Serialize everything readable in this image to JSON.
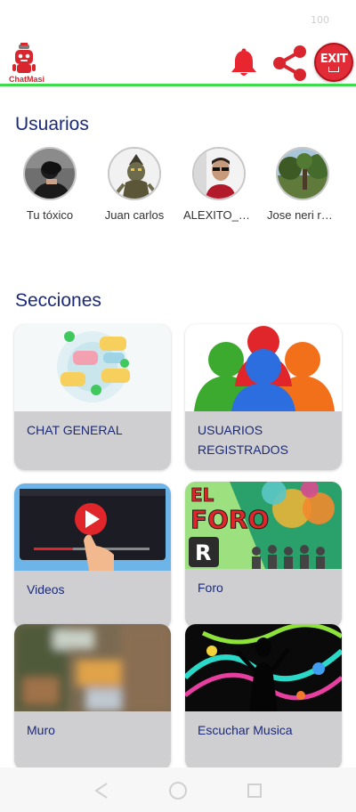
{
  "status_bar": {
    "battery": "100"
  },
  "app_bar": {
    "logo_text": "ChatMasi",
    "exit_label": "EXIT",
    "accent_color": "#3ddc4a",
    "icons": [
      "notification-bell-icon",
      "share-icon",
      "exit-icon"
    ]
  },
  "users_section": {
    "title": "Usuarios",
    "users": [
      {
        "name": "Tu tóxico"
      },
      {
        "name": "Juan carlos"
      },
      {
        "name": "ALEXITO_T…"
      },
      {
        "name": "Jose neri rk…"
      }
    ]
  },
  "sections": {
    "title": "Secciones",
    "cards": [
      {
        "label": "CHAT GENERAL"
      },
      {
        "label_line1": "USUARIOS",
        "label_line2": "REGISTRADOS"
      },
      {
        "label": "Videos"
      },
      {
        "label": "Foro",
        "image_text_line1": "EL",
        "image_text_line2": "FORO"
      },
      {
        "label": "Muro"
      },
      {
        "label": "Escuchar Musica"
      }
    ]
  },
  "nav_bar": {
    "icons": [
      "back-icon",
      "home-icon",
      "recents-icon"
    ]
  }
}
